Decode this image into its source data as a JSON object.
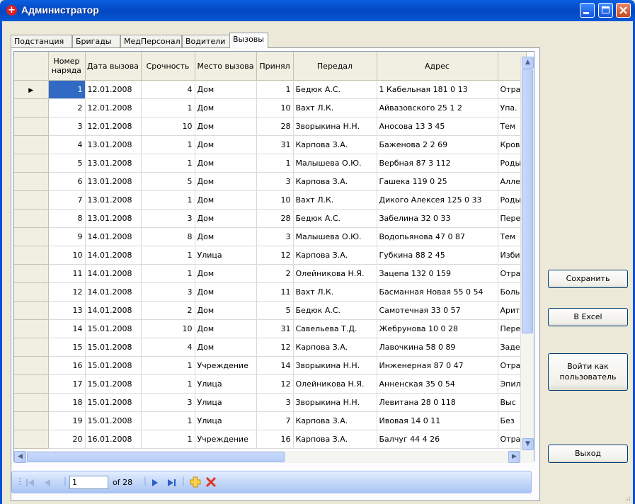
{
  "window": {
    "title": "Администратор"
  },
  "tabs": [
    {
      "label": "Подстанция",
      "active": false
    },
    {
      "label": "Бригады",
      "active": false
    },
    {
      "label": "МедПерсонал",
      "active": false
    },
    {
      "label": "Водители",
      "active": false
    },
    {
      "label": "Вызовы",
      "active": true
    }
  ],
  "grid": {
    "columns": [
      {
        "label": "Номер наряда"
      },
      {
        "label": "Дата вызова"
      },
      {
        "label": "Срочность"
      },
      {
        "label": "Место вызова"
      },
      {
        "label": "Принял"
      },
      {
        "label": "Передал"
      },
      {
        "label": "Адрес"
      },
      {
        "label": ""
      }
    ],
    "rows": [
      {
        "n": "1",
        "date": "12.01.2008",
        "urg": "4",
        "place": "Дом",
        "acc": "1",
        "by": "Бедюк А.С.",
        "addr": "1 Кабельная 181 0 13",
        "extra": "Отра"
      },
      {
        "n": "2",
        "date": "12.01.2008",
        "urg": "1",
        "place": "Дом",
        "acc": "10",
        "by": "Вахт Л.К.",
        "addr": "Айвазовского 25 1 2",
        "extra": "Упа."
      },
      {
        "n": "3",
        "date": "12.01.2008",
        "urg": "10",
        "place": "Дом",
        "acc": "28",
        "by": "Зворыкина Н.Н.",
        "addr": "Аносова 13 3 45",
        "extra": "Тем"
      },
      {
        "n": "4",
        "date": "13.01.2008",
        "urg": "1",
        "place": "Дом",
        "acc": "31",
        "by": "Карпова З.А.",
        "addr": "Баженова 2 2 69",
        "extra": "Кров"
      },
      {
        "n": "5",
        "date": "13.01.2008",
        "urg": "1",
        "place": "Дом",
        "acc": "1",
        "by": "Малышева О.Ю.",
        "addr": "Вербная 87 3 112",
        "extra": "Роды"
      },
      {
        "n": "6",
        "date": "13.01.2008",
        "urg": "5",
        "place": "Дом",
        "acc": "3",
        "by": "Карпова З.А.",
        "addr": "Гашека 119 0 25",
        "extra": "Алле"
      },
      {
        "n": "7",
        "date": "13.01.2008",
        "urg": "1",
        "place": "Дом",
        "acc": "10",
        "by": "Вахт Л.К.",
        "addr": "Дикого Алексея 125 0 33",
        "extra": "Роды"
      },
      {
        "n": "8",
        "date": "13.01.2008",
        "urg": "3",
        "place": "Дом",
        "acc": "28",
        "by": "Бедюк А.С.",
        "addr": "Забелина 32 0 33",
        "extra": "Пере"
      },
      {
        "n": "9",
        "date": "14.01.2008",
        "urg": "8",
        "place": "Дом",
        "acc": "3",
        "by": "Малышева О.Ю.",
        "addr": "Водопьянова 47 0 87",
        "extra": "Тем"
      },
      {
        "n": "10",
        "date": "14.01.2008",
        "urg": "1",
        "place": "Улица",
        "acc": "12",
        "by": "Карпова З.А.",
        "addr": "Губкина 88 2 45",
        "extra": "Изби"
      },
      {
        "n": "11",
        "date": "14.01.2008",
        "urg": "1",
        "place": "Дом",
        "acc": "2",
        "by": "Олейникова Н.Я.",
        "addr": "Зацепа 132 0 159",
        "extra": "Отра"
      },
      {
        "n": "12",
        "date": "14.01.2008",
        "urg": "3",
        "place": "Дом",
        "acc": "11",
        "by": "Вахт Л.К.",
        "addr": "Басманная Новая 55 0 54",
        "extra": "Боль"
      },
      {
        "n": "13",
        "date": "14.01.2008",
        "urg": "2",
        "place": "Дом",
        "acc": "5",
        "by": "Бедюк А.С.",
        "addr": "Самотечная 33 0 57",
        "extra": "Арит"
      },
      {
        "n": "14",
        "date": "15.01.2008",
        "urg": "10",
        "place": "Дом",
        "acc": "31",
        "by": "Савельева Т.Д.",
        "addr": "Жебрунова 10 0 28",
        "extra": "Пере"
      },
      {
        "n": "15",
        "date": "15.01.2008",
        "urg": "4",
        "place": "Дом",
        "acc": "12",
        "by": "Карпова З.А.",
        "addr": "Лавочкина 58 0 89",
        "extra": "Заде"
      },
      {
        "n": "16",
        "date": "15.01.2008",
        "urg": "1",
        "place": "Учреждение",
        "acc": "14",
        "by": "Зворыкина Н.Н.",
        "addr": "Инженерная 87 0 47",
        "extra": "Отра"
      },
      {
        "n": "17",
        "date": "15.01.2008",
        "urg": "1",
        "place": "Улица",
        "acc": "12",
        "by": "Олейникова Н.Я.",
        "addr": "Анненская 35 0 54",
        "extra": "Эпил"
      },
      {
        "n": "18",
        "date": "15.01.2008",
        "urg": "3",
        "place": "Улица",
        "acc": "3",
        "by": "Зворыкина Н.Н.",
        "addr": "Левитана 28 0 118",
        "extra": "Выс"
      },
      {
        "n": "19",
        "date": "15.01.2008",
        "urg": "1",
        "place": "Улица",
        "acc": "7",
        "by": "Карпова З.А.",
        "addr": "Ивовая 14 0 11",
        "extra": "Без"
      },
      {
        "n": "20",
        "date": "16.01.2008",
        "urg": "1",
        "place": "Учреждение",
        "acc": "16",
        "by": "Карпова З.А.",
        "addr": "Балчуг 44 4 26",
        "extra": "Отра"
      }
    ]
  },
  "navigator": {
    "position": "1",
    "of_label": "of 28"
  },
  "buttons": {
    "save": "Сохранить",
    "excel": "В Excel",
    "login_as_user": "Войти как пользователь",
    "exit": "Выход"
  }
}
